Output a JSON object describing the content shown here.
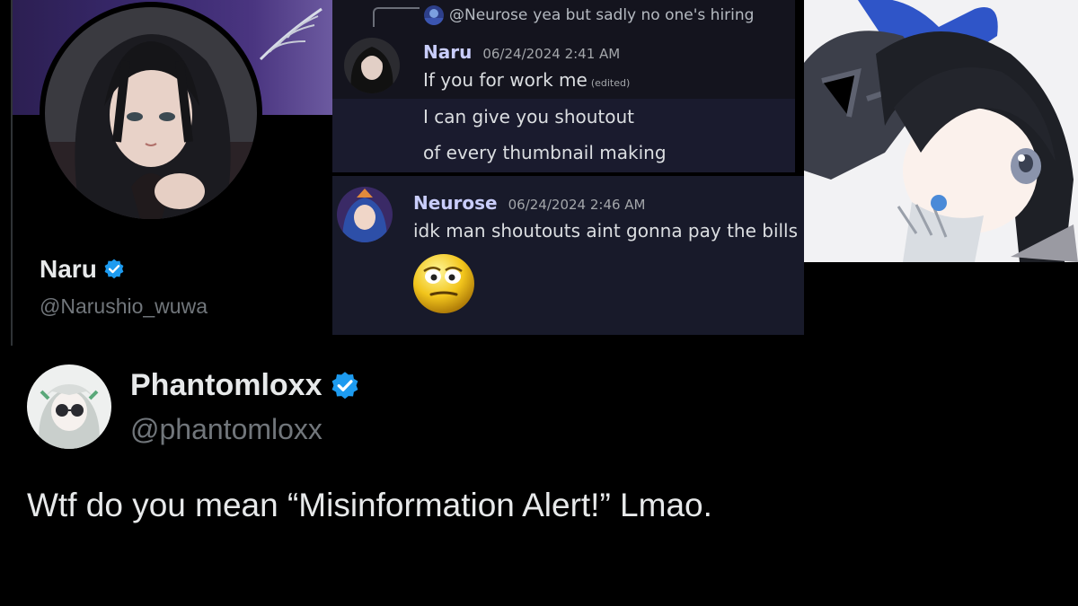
{
  "profile": {
    "name": "Naru",
    "handle": "@Narushio_wuwa",
    "verified_color": "#1d9bf0",
    "avatar_icon": "profile-avatar"
  },
  "discord": {
    "reply": {
      "author": "@Neurose",
      "text": "yea but sadly no one's hiring"
    },
    "message1": {
      "author": "Naru",
      "author_color": "#c9cdfb",
      "timestamp": "06/24/2024 2:41 AM",
      "lines": [
        "If you for work me",
        "I can give you shoutout",
        "of every thumbnail making"
      ],
      "edited_label": "(edited)"
    },
    "message2": {
      "author": "Neurose",
      "author_color": "#c9cdfb",
      "timestamp": "06/24/2024 2:46 AM",
      "text": "idk man shoutouts aint gonna pay the bills",
      "emoji": "flushed-face"
    }
  },
  "tweet": {
    "name": "Phantomloxx",
    "handle": "@phantomloxx",
    "text": "Wtf do you mean “Misinformation Alert!” Lmao.",
    "verified_color": "#1d9bf0"
  }
}
